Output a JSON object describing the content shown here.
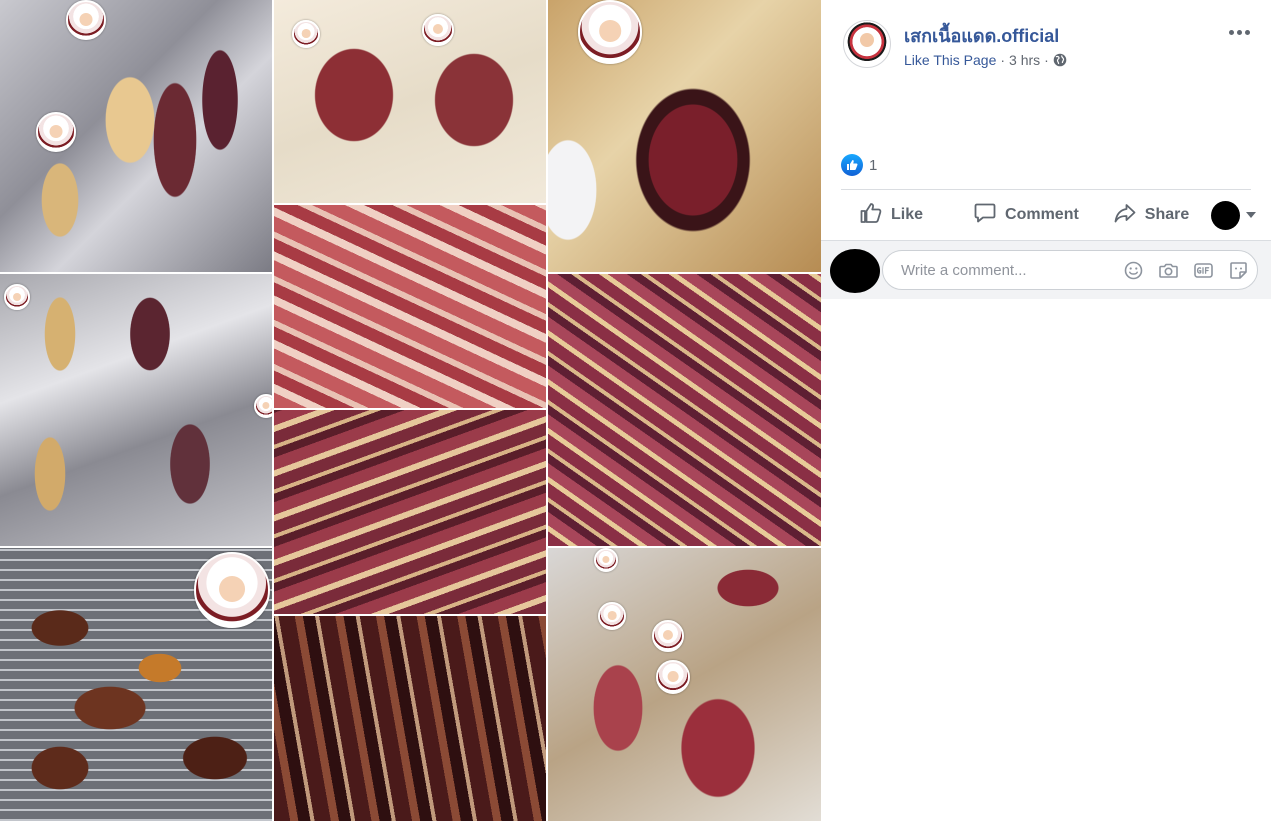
{
  "post": {
    "page_name": "เสกเนื้อแดด.official",
    "like_page": "Like This Page",
    "separator": "·",
    "time": "3 hrs",
    "reaction_count": "1"
  },
  "actions": {
    "like": "Like",
    "comment": "Comment",
    "share": "Share"
  },
  "comment_box": {
    "placeholder": "Write a comment..."
  },
  "icons": {
    "more": "more-options-icon",
    "privacy": "globe-icon",
    "reaction": "thumbs-up-reaction-icon",
    "emoji": "smiley-icon",
    "photo": "camera-icon",
    "gif": "gif-icon",
    "sticker": "sticker-icon"
  },
  "colors": {
    "link_blue": "#365899",
    "meta_gray": "#606770",
    "like_blue": "#1877f2"
  }
}
